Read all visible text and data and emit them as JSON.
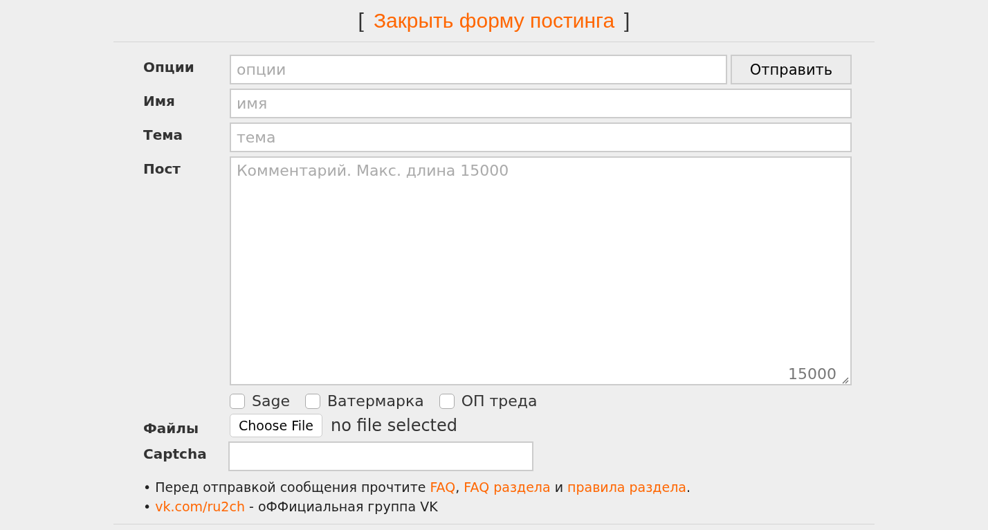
{
  "header": {
    "open_bracket": "[",
    "link": "Закрыть форму постинга",
    "close_bracket": "]"
  },
  "fields": [
    {
      "kind": "input",
      "label": "Опции",
      "placeholder": "опции",
      "button": "Отправить"
    },
    {
      "kind": "input",
      "label": "Имя",
      "placeholder": "имя"
    },
    {
      "kind": "input",
      "label": "Тема",
      "placeholder": "тема"
    },
    {
      "kind": "textarea",
      "label": "Пост",
      "placeholder": "Комментарий. Макс. длина 15000",
      "counter": "15000"
    }
  ],
  "checkboxes": [
    {
      "label": "Sage",
      "checked": false
    },
    {
      "label": "Ватермарка",
      "checked": false
    },
    {
      "label": "ОП треда",
      "checked": false
    }
  ],
  "files": {
    "label": "Файлы",
    "button": "Choose File",
    "status": "no file selected"
  },
  "captcha": {
    "label": "Captcha"
  },
  "notes": [
    [
      {
        "text": "• Перед отправкой сообщения прочтите ",
        "link": false
      },
      {
        "text": "FAQ",
        "link": true
      },
      {
        "text": ", ",
        "link": false
      },
      {
        "text": "FAQ раздела",
        "link": true
      },
      {
        "text": " и ",
        "link": false
      },
      {
        "text": "правила раздела",
        "link": true
      },
      {
        "text": ".",
        "link": false
      }
    ],
    [
      {
        "text": "• ",
        "link": false
      },
      {
        "text": "vk.com/ru2ch",
        "link": true
      },
      {
        "text": " - оФФициальная группа VK",
        "link": false
      }
    ]
  ]
}
